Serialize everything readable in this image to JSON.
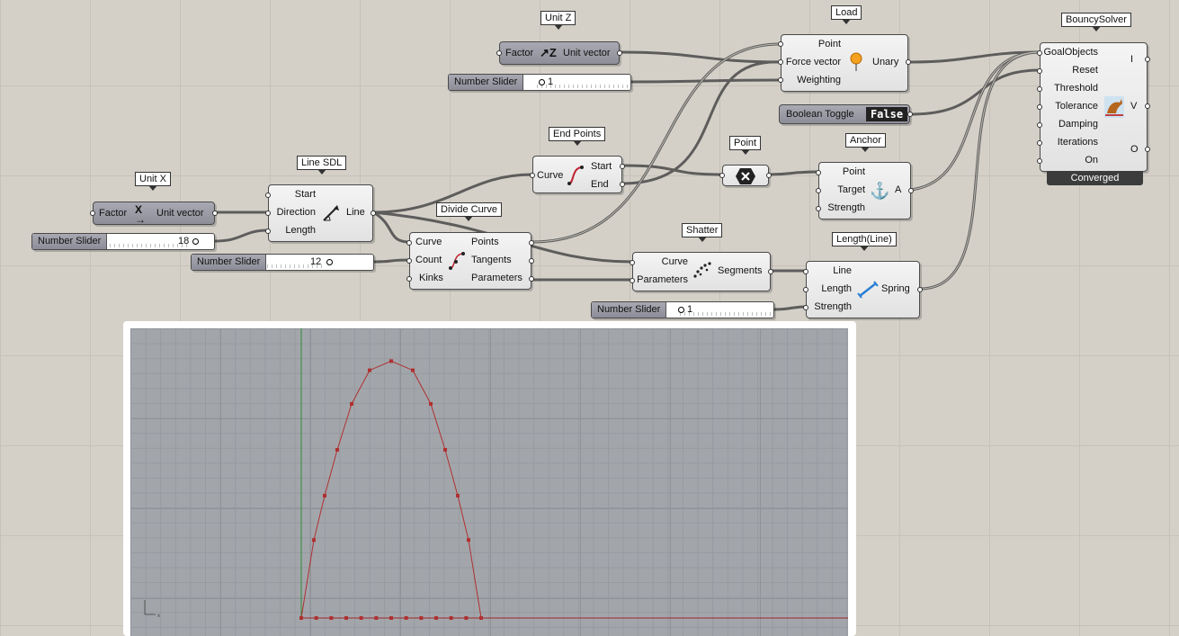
{
  "components": {
    "unit_z": {
      "tag": "Unit Z",
      "in_factor": "Factor",
      "out": "Unit vector"
    },
    "unit_x": {
      "tag": "Unit X",
      "in_factor": "Factor",
      "out": "Unit vector"
    },
    "load": {
      "tag": "Load",
      "in_point": "Point",
      "in_force": "Force vector",
      "in_weighting": "Weighting",
      "out": "Unary"
    },
    "line_sdl": {
      "tag": "Line SDL",
      "in_start": "Start",
      "in_direction": "Direction",
      "in_length": "Length",
      "out": "Line"
    },
    "end_points": {
      "tag": "End Points",
      "in_curve": "Curve",
      "out_start": "Start",
      "out_end": "End"
    },
    "point": {
      "tag": "Point"
    },
    "anchor": {
      "tag": "Anchor",
      "in_point": "Point",
      "in_target": "Target",
      "in_strength": "Strength",
      "out": "A"
    },
    "divide_curve": {
      "tag": "Divide Curve",
      "in_curve": "Curve",
      "in_count": "Count",
      "in_kinks": "Kinks",
      "out_points": "Points",
      "out_tangents": "Tangents",
      "out_parameters": "Parameters"
    },
    "shatter": {
      "tag": "Shatter",
      "in_curve": "Curve",
      "in_parameters": "Parameters",
      "out": "Segments"
    },
    "length_line": {
      "tag": "Length(Line)",
      "in_line": "Line",
      "in_length": "Length",
      "in_strength": "Strength",
      "out": "Spring"
    },
    "boolean_toggle": {
      "label": "Boolean Toggle",
      "value": "False"
    },
    "bouncy_solver": {
      "tag": "BouncySolver",
      "in_goal": "GoalObjects",
      "in_reset": "Reset",
      "in_threshold": "Threshold",
      "in_tolerance": "Tolerance",
      "in_damping": "Damping",
      "in_iterations": "Iterations",
      "in_on": "On",
      "out_i": "I",
      "out_v": "V",
      "out_o": "O",
      "status": "Converged"
    }
  },
  "sliders": {
    "weighting": {
      "label": "Number Slider",
      "value": "1"
    },
    "length": {
      "label": "Number Slider",
      "value": "18"
    },
    "count": {
      "label": "Number Slider",
      "value": "12"
    },
    "strength": {
      "label": "Number Slider",
      "value": "1"
    }
  },
  "viewport": {
    "axis_x": "x",
    "curve_color": "#b03030",
    "arch_points": [
      [
        0,
        0
      ],
      [
        0.07,
        0.51
      ],
      [
        0.13,
        0.8
      ],
      [
        0.2,
        1.1
      ],
      [
        0.28,
        1.4
      ],
      [
        0.38,
        1.62
      ],
      [
        0.5,
        1.68
      ],
      [
        0.62,
        1.62
      ],
      [
        0.72,
        1.4
      ],
      [
        0.8,
        1.1
      ],
      [
        0.87,
        0.8
      ],
      [
        0.93,
        0.51
      ],
      [
        1,
        0
      ]
    ]
  },
  "colors": {
    "canvas": "#d4d0c8",
    "wire": "#4a4a4a",
    "component": "#e6e6e6",
    "slider_label": "#9e9ea8",
    "converged_bar": "#3c3c3c"
  }
}
